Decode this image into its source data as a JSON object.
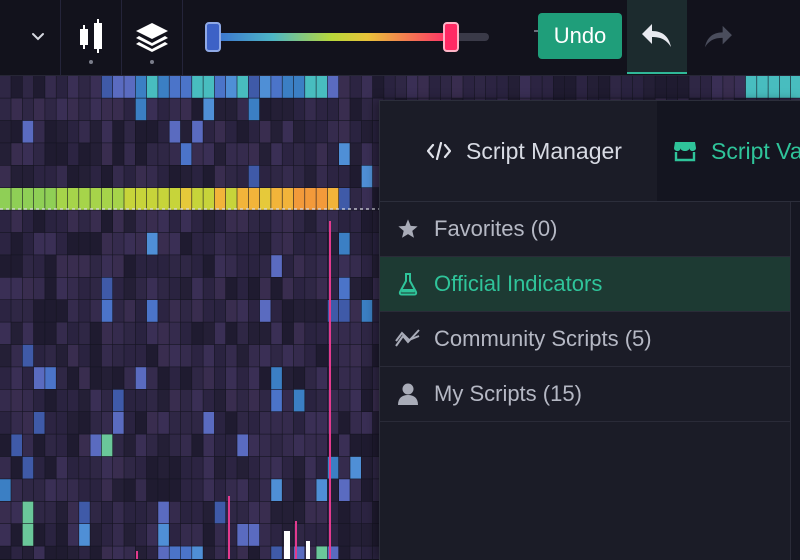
{
  "toolbar": {
    "undo_label": "Undo",
    "range_slider": {
      "low": 0.0,
      "high": 0.86
    },
    "icons": [
      "chevron-down-icon",
      "candlestick-icon",
      "layers-icon",
      "undo-arrow-icon",
      "redo-arrow-icon"
    ]
  },
  "panel": {
    "tabs": [
      {
        "label": "Script Manager",
        "icon": "code-icon"
      },
      {
        "label": "Script Va",
        "icon": "store-icon"
      }
    ],
    "categories": [
      {
        "label": "Favorites (0)",
        "icon": "star-icon"
      },
      {
        "label": "Official Indicators",
        "icon": "flask-icon",
        "active": true
      },
      {
        "label": "Community Scripts (5)",
        "icon": "trend-lines-icon"
      },
      {
        "label": "My Scripts (15)",
        "icon": "user-icon"
      }
    ]
  },
  "colors": {
    "accent": "#2fc49a",
    "undo_button": "#1f9e7a",
    "background": "#151421",
    "panel": "#1b1c27",
    "active_row": "#1d3a33"
  }
}
